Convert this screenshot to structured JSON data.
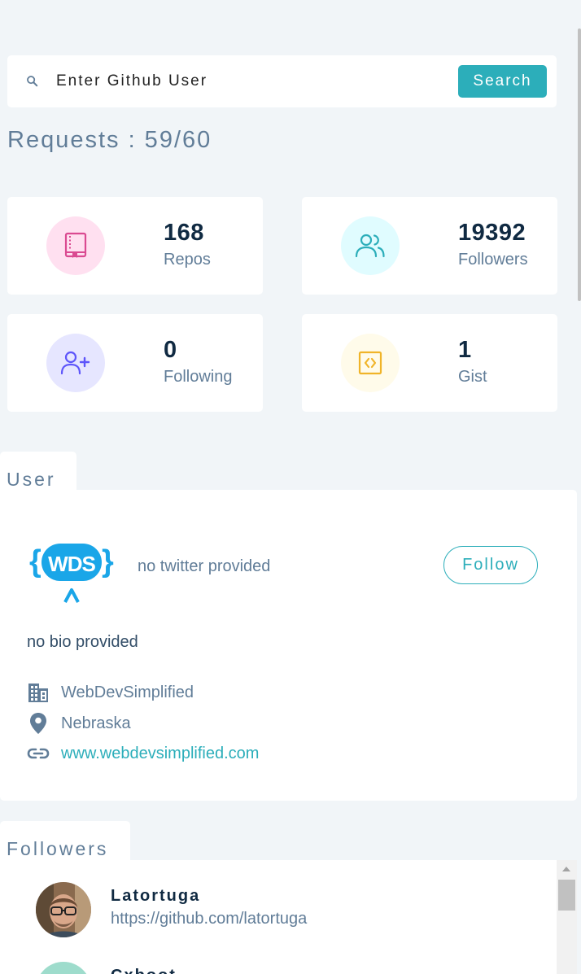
{
  "search": {
    "placeholder": "Enter Github User",
    "button_label": "Search"
  },
  "requests": {
    "text": "Requests : 59/60"
  },
  "stats": [
    {
      "value": "168",
      "label": "Repos",
      "icon": "book-icon",
      "color": "#da4a91",
      "bg": "#ffe0f0"
    },
    {
      "value": "19392",
      "label": "Followers",
      "icon": "users-icon",
      "color": "#2caeba",
      "bg": "#e0fcff"
    },
    {
      "value": "0",
      "label": "Following",
      "icon": "user-plus-icon",
      "color": "#5d55fa",
      "bg": "#e6e6ff"
    },
    {
      "value": "1",
      "label": "Gist",
      "icon": "code-icon",
      "color": "#f0b429",
      "bg": "#fffbea"
    }
  ],
  "user_section": {
    "tab_label": "User",
    "twitter": "no twitter provided",
    "follow_label": "Follow",
    "bio": "no bio provided",
    "company": "WebDevSimplified",
    "location": "Nebraska",
    "blog": "www.webdevsimplified.com",
    "logo_text": "{WDS}"
  },
  "followers_section": {
    "tab_label": "Followers",
    "items": [
      {
        "name": "Latortuga",
        "url": "https://github.com/latortuga"
      },
      {
        "name": "Cxboot",
        "url": ""
      }
    ]
  },
  "colors": {
    "accent": "#2caeba",
    "background": "#f1f5f8",
    "text_dark": "#102a42",
    "text_muted": "#617d98"
  }
}
